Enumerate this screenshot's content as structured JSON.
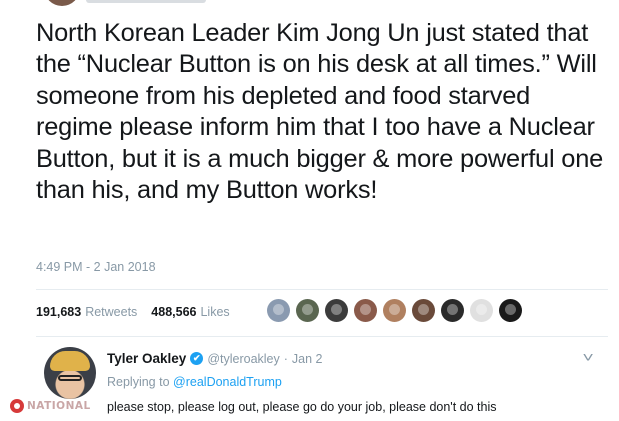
{
  "tweet": {
    "text": "North Korean Leader Kim Jong Un just stated that the “Nuclear Button is on his desk at all times.” Will someone from his depleted and food starved regime please inform him that I too have a Nuclear Button, but it is a much bigger & more powerful one than his, and my Button works!",
    "timestamp": "4:49 PM - 2 Jan 2018",
    "retweets_count": "191,683",
    "retweets_label": "Retweets",
    "likes_count": "488,566",
    "likes_label": "Likes",
    "liker_colors": [
      "#8a9ab0",
      "#5a6650",
      "#3c3c3c",
      "#8a5a4a",
      "#b08060",
      "#6a4a3a",
      "#2a2a2a",
      "#e0e0e0",
      "#1a1a1a"
    ]
  },
  "reply": {
    "name": "Tyler Oakley",
    "verified_glyph": "✔",
    "handle": "@tyleroakley",
    "separator": "·",
    "date": "Jan 2",
    "replying_prefix": "Replying to",
    "replying_to": "@realDonaldTrump",
    "text": "please stop, please log out, please go do your job, please don't do this",
    "menu_glyph": "˅"
  },
  "watermark": {
    "text": "NATIONAL"
  }
}
